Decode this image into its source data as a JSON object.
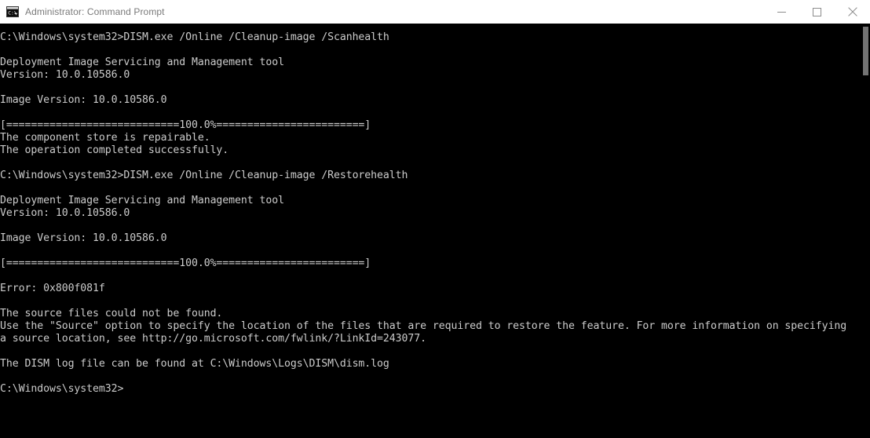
{
  "window": {
    "title": "Administrator: Command Prompt",
    "icon": "cmd-console-icon",
    "icon_label": "C:\\",
    "colors": {
      "titlebar_bg": "#ffffff",
      "titlebar_text": "#7a7a7a",
      "console_bg": "#000000",
      "console_text": "#cccccc",
      "scrollbar_thumb": "#9a9a9a"
    },
    "controls": {
      "minimize": "Minimize",
      "maximize": "Maximize",
      "close": "Close"
    }
  },
  "console": {
    "prompt": "C:\\Windows\\system32>",
    "lines": [
      "C:\\Windows\\system32>DISM.exe /Online /Cleanup-image /Scanhealth",
      "",
      "Deployment Image Servicing and Management tool",
      "Version: 10.0.10586.0",
      "",
      "Image Version: 10.0.10586.0",
      "",
      "[============================100.0%========================]",
      "The component store is repairable.",
      "The operation completed successfully.",
      "",
      "C:\\Windows\\system32>DISM.exe /Online /Cleanup-image /Restorehealth",
      "",
      "Deployment Image Servicing and Management tool",
      "Version: 10.0.10586.0",
      "",
      "Image Version: 10.0.10586.0",
      "",
      "[============================100.0%========================]",
      "",
      "Error: 0x800f081f",
      "",
      "The source files could not be found.",
      "Use the \"Source\" option to specify the location of the files that are required to restore the feature. For more information on specifying",
      "a source location, see http://go.microsoft.com/fwlink/?LinkId=243077.",
      "",
      "The DISM log file can be found at C:\\Windows\\Logs\\DISM\\dism.log",
      "",
      "C:\\Windows\\system32>"
    ],
    "commands": [
      "DISM.exe /Online /Cleanup-image /Scanhealth",
      "DISM.exe /Online /Cleanup-image /Restorehealth"
    ],
    "tool_name": "Deployment Image Servicing and Management tool",
    "version": "10.0.10586.0",
    "image_version": "10.0.10586.0",
    "progress_percent": "100.0%",
    "status_messages": [
      "The component store is repairable.",
      "The operation completed successfully."
    ],
    "error_code": "Error: 0x800f081f",
    "error_detail": "The source files could not be found.",
    "log_path": "C:\\Windows\\Logs\\DISM\\dism.log",
    "help_url": "http://go.microsoft.com/fwlink/?LinkId=243077"
  },
  "scrollbar": {
    "thumb_position_percent": 2,
    "thumb_size_percent": 12
  }
}
